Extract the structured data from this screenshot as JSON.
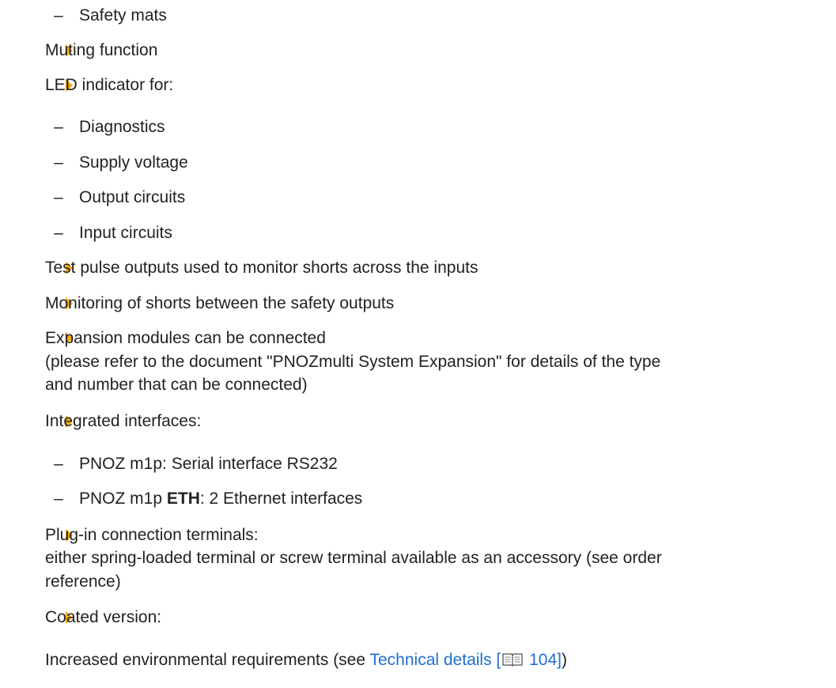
{
  "items": {
    "safety_mats": "Safety mats",
    "muting": "Muting function",
    "led_indicator": "LED indicator for:",
    "diagnostics": "Diagnostics",
    "supply_voltage": "Supply voltage",
    "output_circuits": "Output circuits",
    "input_circuits": "Input circuits",
    "test_pulse": "Test pulse outputs used to monitor shorts across the inputs",
    "monitoring_shorts": "Monitoring of shorts between the safety outputs",
    "expansion_line1": "Expansion modules can be connected",
    "expansion_line2": "(please refer to the document \"PNOZmulti System Expansion\" for details of the type",
    "expansion_line3": "and number that can be connected)",
    "integrated_interfaces": "Integrated interfaces:",
    "m1p_serial": "PNOZ m1p: Serial interface RS232",
    "m1p_eth_prefix": "PNOZ m1p ",
    "m1p_eth_bold": "ETH",
    "m1p_eth_suffix": ": 2 Ethernet interfaces",
    "plugin_line1": "Plug-in connection terminals:",
    "plugin_line2": "either spring-loaded terminal or screw terminal available as an accessory (see order",
    "plugin_line3": "reference)",
    "coated": "Coated version:",
    "increased_prefix": "Increased environmental requirements (see ",
    "technical_link": "Technical details [",
    "technical_page": " 104]",
    "increased_suffix": ")"
  },
  "dash_char": "–",
  "colors": {
    "bullet": "#f5a800",
    "link": "#1f6fd1",
    "text": "#222222"
  },
  "icons": {
    "bullet": "triangle-bullet-icon",
    "reference": "book-icon"
  }
}
